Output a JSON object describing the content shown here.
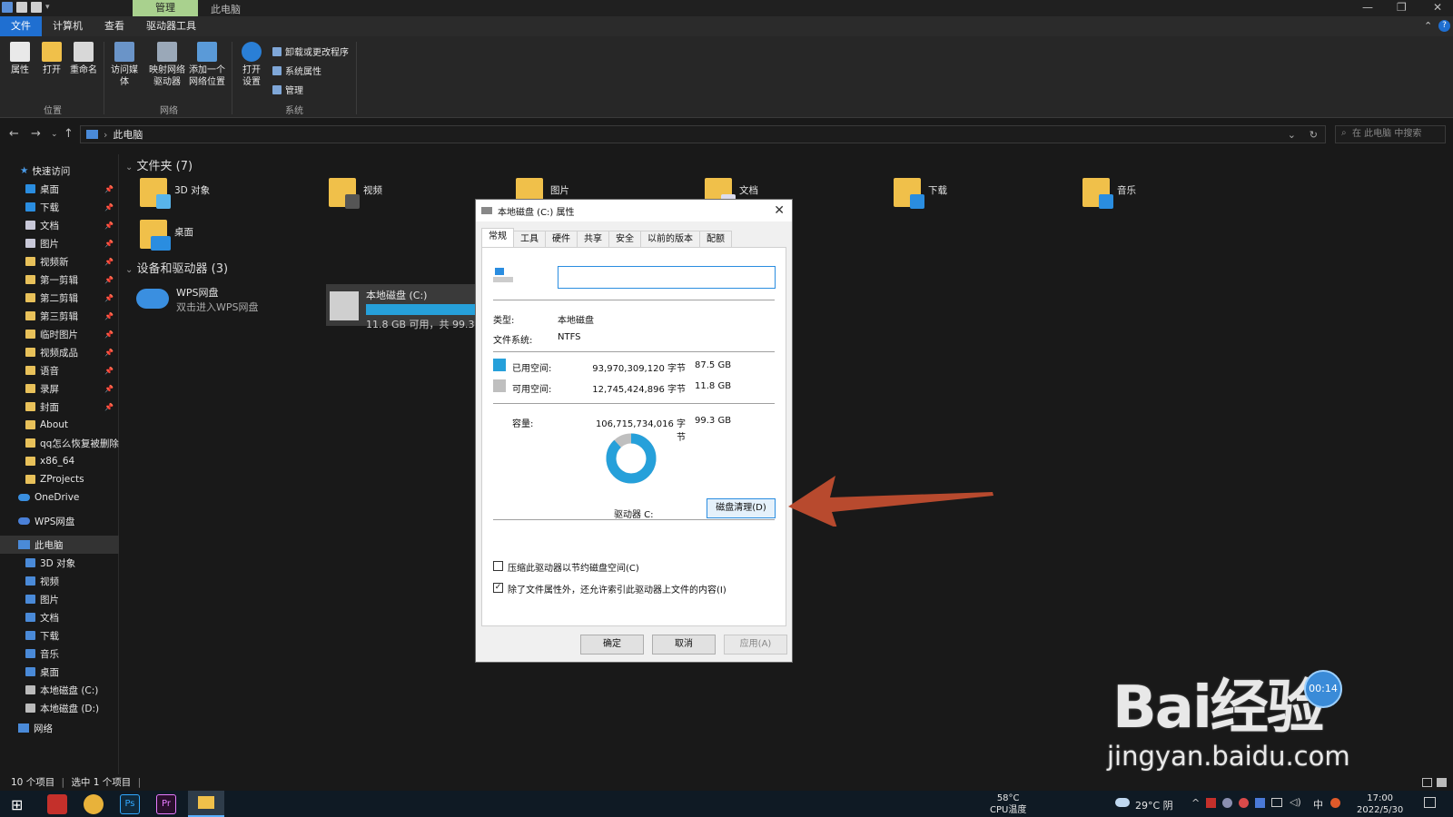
{
  "titlebar": {
    "context_tab": "管理",
    "title": "此电脑"
  },
  "ribbon": {
    "tabs": [
      "文件",
      "计算机",
      "查看",
      "驱动器工具"
    ],
    "buttons": {
      "properties": "属性",
      "open": "打开",
      "rename": "重命名",
      "media_a": "访问媒体",
      "map_drive_a": "映射网络",
      "map_drive_b": "驱动器",
      "add_loc_a": "添加一个",
      "add_loc_b": "网络位置",
      "settings_a": "打开",
      "settings_b": "设置"
    },
    "small": {
      "uninstall": "卸载或更改程序",
      "sysprops": "系统属性",
      "manage": "管理"
    },
    "groups": {
      "location": "位置",
      "network": "网络",
      "system": "系统"
    }
  },
  "address": {
    "path": "此电脑",
    "search_placeholder": "在 此电脑 中搜索"
  },
  "sidebar": {
    "quick_access": "快速访问",
    "items": [
      "桌面",
      "下载",
      "文档",
      "图片",
      "视频新",
      "第一剪辑",
      "第二剪辑",
      "第三剪辑",
      "临时图片",
      "视频成品",
      "语音",
      "录屏",
      "封面",
      "About",
      "qq怎么恢复被删除",
      "x86_64",
      "ZProjects"
    ],
    "onedrive": "OneDrive",
    "wps": "WPS网盘",
    "thispc": "此电脑",
    "pc_items": [
      "3D 对象",
      "视频",
      "图片",
      "文档",
      "下载",
      "音乐",
      "桌面",
      "本地磁盘 (C:)",
      "本地磁盘 (D:)"
    ],
    "network": "网络"
  },
  "content": {
    "folders_header": "文件夹 (7)",
    "folders": [
      "3D 对象",
      "视频",
      "图片",
      "文档",
      "下载",
      "音乐",
      "桌面"
    ],
    "devices_header": "设备和驱动器 (3)",
    "wps_name": "WPS网盘",
    "wps_sub": "双击进入WPS网盘",
    "drive_c_name": "本地磁盘 (C:)",
    "drive_c_info": "11.8 GB 可用，共 99.3 GB"
  },
  "status": {
    "count": "10 个项目",
    "selected": "选中 1 个项目"
  },
  "dialog": {
    "title": "本地磁盘 (C:) 属性",
    "tabs": [
      "常规",
      "工具",
      "硬件",
      "共享",
      "安全",
      "以前的版本",
      "配额"
    ],
    "name_value": "",
    "type_label": "类型:",
    "type_value": "本地磁盘",
    "fs_label": "文件系统:",
    "fs_value": "NTFS",
    "used_label": "已用空间:",
    "used_bytes": "93,970,309,120 字节",
    "used_gb": "87.5 GB",
    "free_label": "可用空间:",
    "free_bytes": "12,745,424,896 字节",
    "free_gb": "11.8 GB",
    "cap_label": "容量:",
    "cap_bytes": "106,715,734,016 字节",
    "cap_gb": "99.3 GB",
    "drive_label": "驱动器 C:",
    "cleanup": "磁盘清理(D)",
    "compress": "压缩此驱动器以节约磁盘空间(C)",
    "index": "除了文件属性外，还允许索引此驱动器上文件的内容(I)",
    "ok": "确定",
    "cancel": "取消",
    "apply": "应用(A)",
    "used_fraction": 0.88,
    "colors": {
      "used": "#26a0da",
      "free": "#bfbfbf"
    }
  },
  "taskbar": {
    "temp": "58°C",
    "temp_label": "CPU温度",
    "weather": "29°C 阴",
    "ime": "中",
    "time": "17:00",
    "date": "2022/5/30"
  },
  "overlay": {
    "timer": "00:14",
    "watermark": "Bai经验",
    "watermark_url": "jingyan.baidu.com"
  }
}
